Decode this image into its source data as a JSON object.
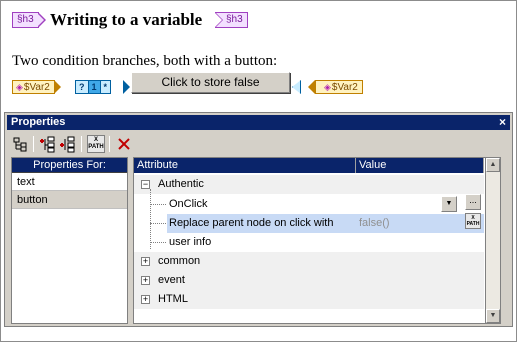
{
  "document": {
    "heading_tag_start": "§h3",
    "heading_text": "Writing to a variable",
    "heading_tag_end": "§h3",
    "sentence": "Two condition branches, both with a button:",
    "var_left": "$Var2",
    "var_right": "$Var2",
    "condition": {
      "question": "?",
      "branch_1": "1",
      "branch_star": "*"
    },
    "button_label": "Click to store false"
  },
  "properties": {
    "title": "Properties",
    "close_label": "×",
    "left_header": "Properties For:",
    "left_items": [
      "text",
      "button"
    ],
    "col_attribute": "Attribute",
    "col_value": "Value",
    "rows": {
      "authentic": "Authentic",
      "onclick": "OnClick",
      "replace": "Replace parent node on click with",
      "replace_value": "false()",
      "userinfo": "user info",
      "common": "common",
      "event": "event",
      "html": "HTML"
    },
    "ellipsis": "...",
    "xpath_label_top": "X",
    "xpath_label_bottom": "PATH"
  },
  "colors": {
    "titlebar": "#0a246a",
    "tag_purple": "#a040c0",
    "var_orange": "#c08000",
    "cond_blue": "#0060a0",
    "selected_row": "#c8daf5"
  }
}
